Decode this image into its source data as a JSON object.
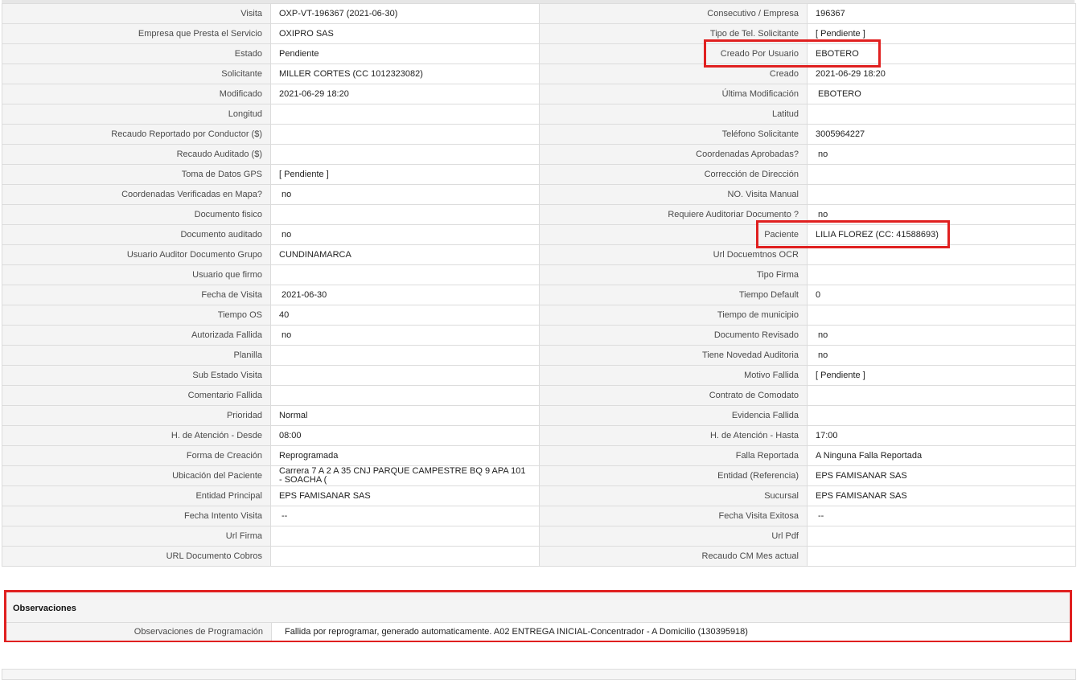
{
  "rows": [
    {
      "l1": "Visita",
      "v1": "OXP-VT-196367 (2021-06-30)",
      "l2": "Consecutivo / Empresa",
      "v2": "196367"
    },
    {
      "l1": "Empresa que Presta el Servicio",
      "v1": "OXIPRO SAS",
      "l2": "Tipo de Tel. Solicitante",
      "v2": "[ Pendiente ]"
    },
    {
      "l1": "Estado",
      "v1": "Pendiente",
      "l2": "Creado Por Usuario",
      "v2": "EBOTERO"
    },
    {
      "l1": "Solicitante",
      "v1": "MILLER CORTES (CC 1012323082)",
      "l2": "Creado",
      "v2": "2021-06-29 18:20"
    },
    {
      "l1": "Modificado",
      "v1": "2021-06-29 18:20",
      "l2": "Última Modificación",
      "v2": "EBOTERO"
    },
    {
      "l1": "Longitud",
      "v1": "",
      "l2": "Latitud",
      "v2": ""
    },
    {
      "l1": "Recaudo Reportado por Conductor ($)",
      "v1": "",
      "l2": "Teléfono Solicitante",
      "v2": "3005964227"
    },
    {
      "l1": "Recaudo Auditado ($)",
      "v1": "",
      "l2": "Coordenadas Aprobadas?",
      "v2": "no"
    },
    {
      "l1": "Toma de Datos GPS",
      "v1": "[ Pendiente ]",
      "l2": "Corrección de Dirección",
      "v2": ""
    },
    {
      "l1": "Coordenadas Verificadas en Mapa?",
      "v1": "no",
      "l2": "NO. Visita Manual",
      "v2": ""
    },
    {
      "l1": "Documento fisico",
      "v1": "",
      "l2": "Requiere Auditoriar Documento ?",
      "v2": "no"
    },
    {
      "l1": "Documento auditado",
      "v1": "no",
      "l2": "Paciente",
      "v2": "LILIA FLOREZ (CC: 41588693)"
    },
    {
      "l1": "Usuario Auditor Documento Grupo",
      "v1": "CUNDINAMARCA",
      "l2": "Url Docuemtnos OCR",
      "v2": ""
    },
    {
      "l1": "Usuario que firmo",
      "v1": "",
      "l2": "Tipo Firma",
      "v2": ""
    },
    {
      "l1": "Fecha de Visita",
      "v1": "2021-06-30",
      "l2": "Tiempo Default",
      "v2": "0"
    },
    {
      "l1": "Tiempo OS",
      "v1": "40",
      "l2": "Tiempo de municipio",
      "v2": ""
    },
    {
      "l1": "Autorizada Fallida",
      "v1": "no",
      "l2": "Documento Revisado",
      "v2": "no"
    },
    {
      "l1": "Planilla",
      "v1": "",
      "l2": "Tiene Novedad Auditoria",
      "v2": "no"
    },
    {
      "l1": "Sub Estado Visita",
      "v1": "",
      "l2": "Motivo Fallida",
      "v2": "[ Pendiente ]"
    },
    {
      "l1": "Comentario Fallida",
      "v1": "",
      "l2": "Contrato de Comodato",
      "v2": ""
    },
    {
      "l1": "Prioridad",
      "v1": "Normal",
      "l2": "Evidencia Fallida",
      "v2": ""
    },
    {
      "l1": "H. de Atención - Desde",
      "v1": "08:00",
      "l2": "H. de Atención - Hasta",
      "v2": "17:00"
    },
    {
      "l1": "Forma de Creación",
      "v1": "Reprogramada",
      "l2": "Falla Reportada",
      "v2": "A Ninguna Falla Reportada"
    },
    {
      "l1": "Ubicación del Paciente",
      "v1": "Carrera 7 A 2 A 35 CNJ PARQUE CAMPESTRE BQ 9 APA 101 - SOACHA (",
      "l2": "Entidad (Referencia)",
      "v2": "EPS FAMISANAR SAS"
    },
    {
      "l1": "Entidad Principal",
      "v1": "EPS FAMISANAR SAS",
      "l2": "Sucursal",
      "v2": "EPS FAMISANAR SAS"
    },
    {
      "l1": "Fecha Intento Visita",
      "v1": "--",
      "l2": "Fecha Visita Exitosa",
      "v2": "--"
    },
    {
      "l1": "Url Firma",
      "v1": "",
      "l2": "Url Pdf",
      "v2": ""
    },
    {
      "l1": "URL Documento Cobros",
      "v1": "",
      "l2": "Recaudo CM Mes actual",
      "v2": ""
    }
  ],
  "observaciones": {
    "title": "Observaciones",
    "label": "Observaciones de Programación",
    "value": "Fallida por reprogramar, generado automaticamente. A02 ENTREGA INICIAL-Concentrador - A Domicilio (130395918)"
  },
  "colors": {
    "highlight": "#e02020",
    "label_bg": "#f4f4f4",
    "border": "#dcdcdc"
  }
}
